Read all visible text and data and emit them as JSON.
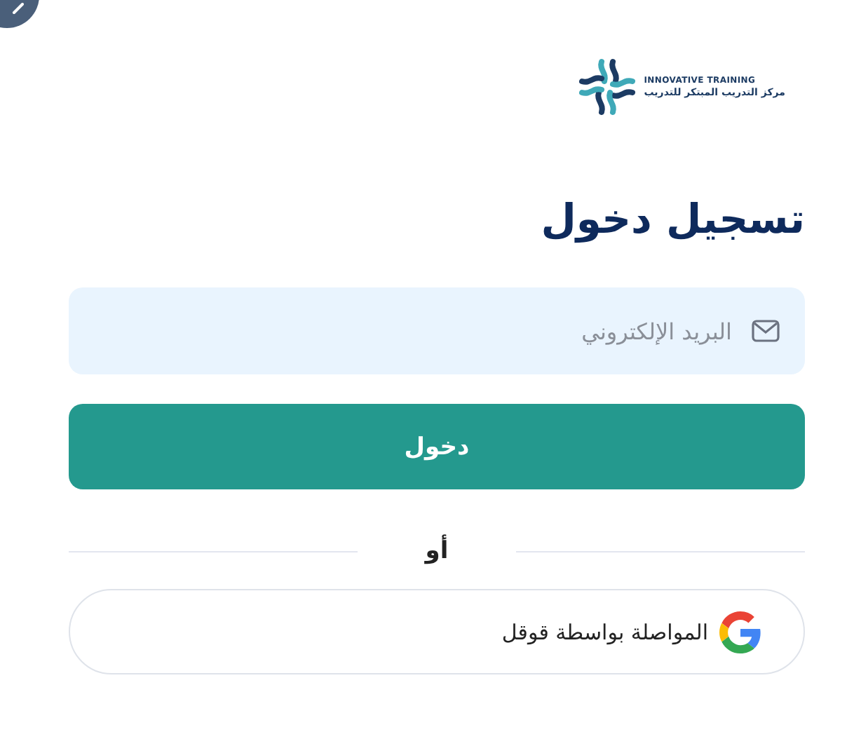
{
  "logo": {
    "name": "INNOVATIVE TRAINING",
    "arabic_name": "مركز التدريب المبتكر للتدريب"
  },
  "title": "تسجيل دخول",
  "email_field": {
    "placeholder": "البريد الإلكتروني"
  },
  "login_button": {
    "label": "دخول"
  },
  "divider": {
    "label": "أو"
  },
  "google_button": {
    "label": "المواصلة بواسطة قوقل"
  }
}
